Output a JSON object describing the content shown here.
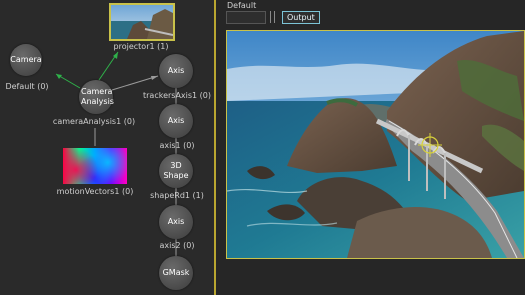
{
  "nodegraph": {
    "nodes": {
      "camera": {
        "title": "Camera",
        "label": "Default (0)"
      },
      "camera_analysis": {
        "title": "Camera Analysis",
        "label": "cameraAnalysis1 (0)"
      },
      "axis_top": {
        "title": "Axis",
        "label": "trackersAxis1 (0)"
      },
      "axis_mid": {
        "title": "Axis",
        "label": "axis1 (0)"
      },
      "shape3d": {
        "title": "3D Shape",
        "label": "shapeRd1 (1)"
      },
      "axis_bot": {
        "title": "Axis",
        "label": "axis2 (0)"
      },
      "gmask": {
        "title": "GMask",
        "label": ""
      }
    },
    "projector_label": "projector1 (1)",
    "motion_vectors_label": "motionVectors1 (0)"
  },
  "viewer": {
    "name": "Default",
    "button_off_label": "",
    "output_label": "Output"
  },
  "colors": {
    "accent_yellow": "#c9c24a",
    "output_outline": "#7cc4d6",
    "wire": "#9a9a9a",
    "green_arrow": "#2fb24a"
  }
}
